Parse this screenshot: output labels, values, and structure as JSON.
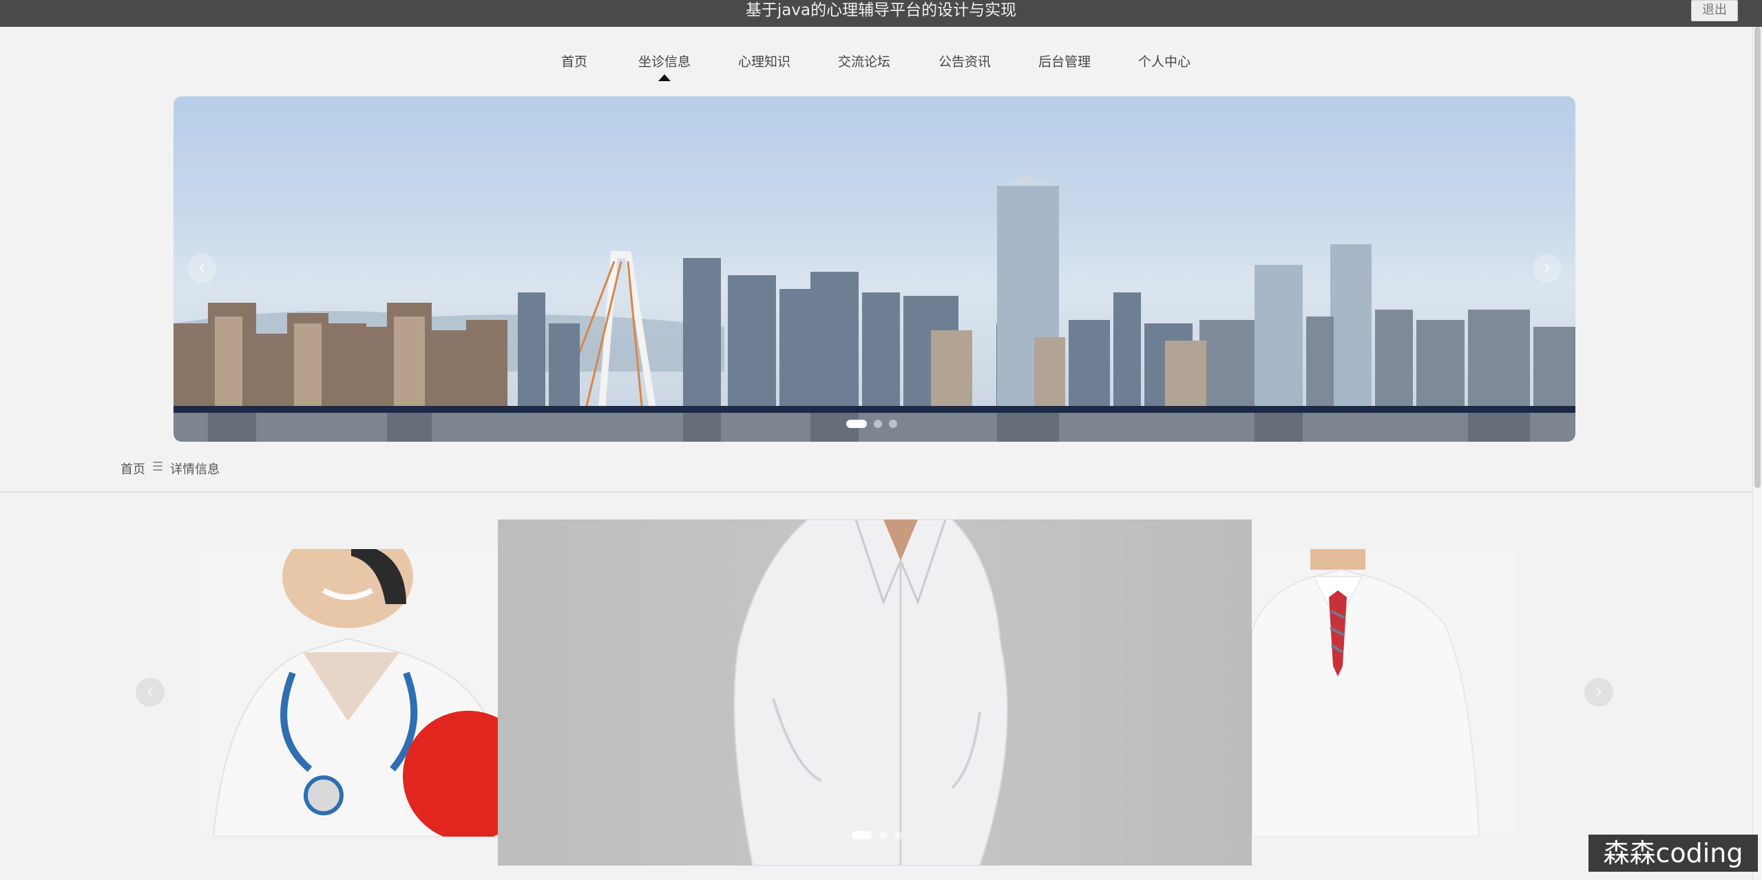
{
  "header": {
    "title": "基于java的心理辅导平台的设计与实现",
    "logout_label": "退出"
  },
  "nav": {
    "items": [
      {
        "label": "首页",
        "active": false
      },
      {
        "label": "坐诊信息",
        "active": true
      },
      {
        "label": "心理知识",
        "active": false
      },
      {
        "label": "交流论坛",
        "active": false
      },
      {
        "label": "公告资讯",
        "active": false
      },
      {
        "label": "后台管理",
        "active": false
      },
      {
        "label": "个人中心",
        "active": false
      }
    ]
  },
  "banner": {
    "prev_arrow": "‹",
    "next_arrow": "›",
    "slide_count": 3,
    "active_slide": 1
  },
  "breadcrumb": {
    "home": "首页",
    "separator": "☰",
    "current": "详情信息"
  },
  "carousel": {
    "prev_arrow": "‹",
    "next_arrow": "›",
    "slide_count": 3,
    "active_slide": 1
  },
  "watermark": {
    "text": "森森coding"
  },
  "colors": {
    "topbar": "#4a4a4a",
    "background": "#f2f2f2",
    "accent_red": "#e0261e"
  }
}
